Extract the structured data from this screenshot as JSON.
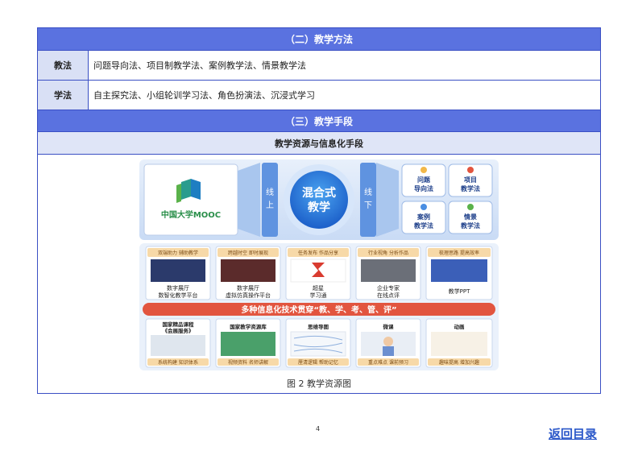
{
  "section2": {
    "title": "（二）教学方法",
    "rows": [
      {
        "label": "教法",
        "content": "问题导向法、项目制教学法、案例教学法、情景教学法"
      },
      {
        "label": "学法",
        "content": "自主探究法、小组轮训学习法、角色扮演法、沉浸式学习"
      }
    ]
  },
  "section3": {
    "title": "（三）教学手段",
    "subtitle": "教学资源与信息化手段"
  },
  "figure": {
    "mooc_logo": "中国大学MOOC",
    "online": "线上",
    "offline": "线下",
    "center_line1": "混合式",
    "center_line2": "教学",
    "methods": [
      {
        "line1": "问题",
        "line2": "导向法"
      },
      {
        "line1": "项目",
        "line2": "教学法"
      },
      {
        "line1": "案例",
        "line2": "教学法"
      },
      {
        "line1": "情景",
        "line2": "教学法"
      }
    ],
    "top_cards": [
      {
        "tag": "双端助力  辅助教学",
        "line1": "数字展厅",
        "line2": "数智化教学平台"
      },
      {
        "tag": "跨越时空  即时展现",
        "line1": "数字展厅",
        "line2": "虚拟仿真操作平台"
      },
      {
        "tag": "任务发布  作品分享",
        "line1": "超星",
        "line2": "学习通"
      },
      {
        "tag": "行业视角  分析作品",
        "line1": "企业专家",
        "line2": "在线点评"
      },
      {
        "tag": "梳理思路  提高效率",
        "line1": "教学PPT",
        "line2": ""
      }
    ],
    "banner": "多种信息化技术贯穿“教、学、考、管、评”",
    "bottom_cards": [
      {
        "title": "国家精品课程\n《会展服务》",
        "tag": "系统构建  知识体系"
      },
      {
        "title": "国家教学资源库",
        "tag": "视频资料  名师讲解"
      },
      {
        "title": "思维导图",
        "tag": "厘清逻辑  帮助记忆"
      },
      {
        "title": "微课",
        "tag": "重点难点  课前预习"
      },
      {
        "title": "动画",
        "tag": "趣味提高  增加兴趣"
      }
    ],
    "caption": "图 2   教学资源图"
  },
  "page_number": "4",
  "back_link": "返回目录",
  "colors": {
    "header_blue": "#5a72e0",
    "label_bg": "#d9e0f5",
    "banner_red": "#e2553f",
    "link_blue": "#2a57c9"
  }
}
